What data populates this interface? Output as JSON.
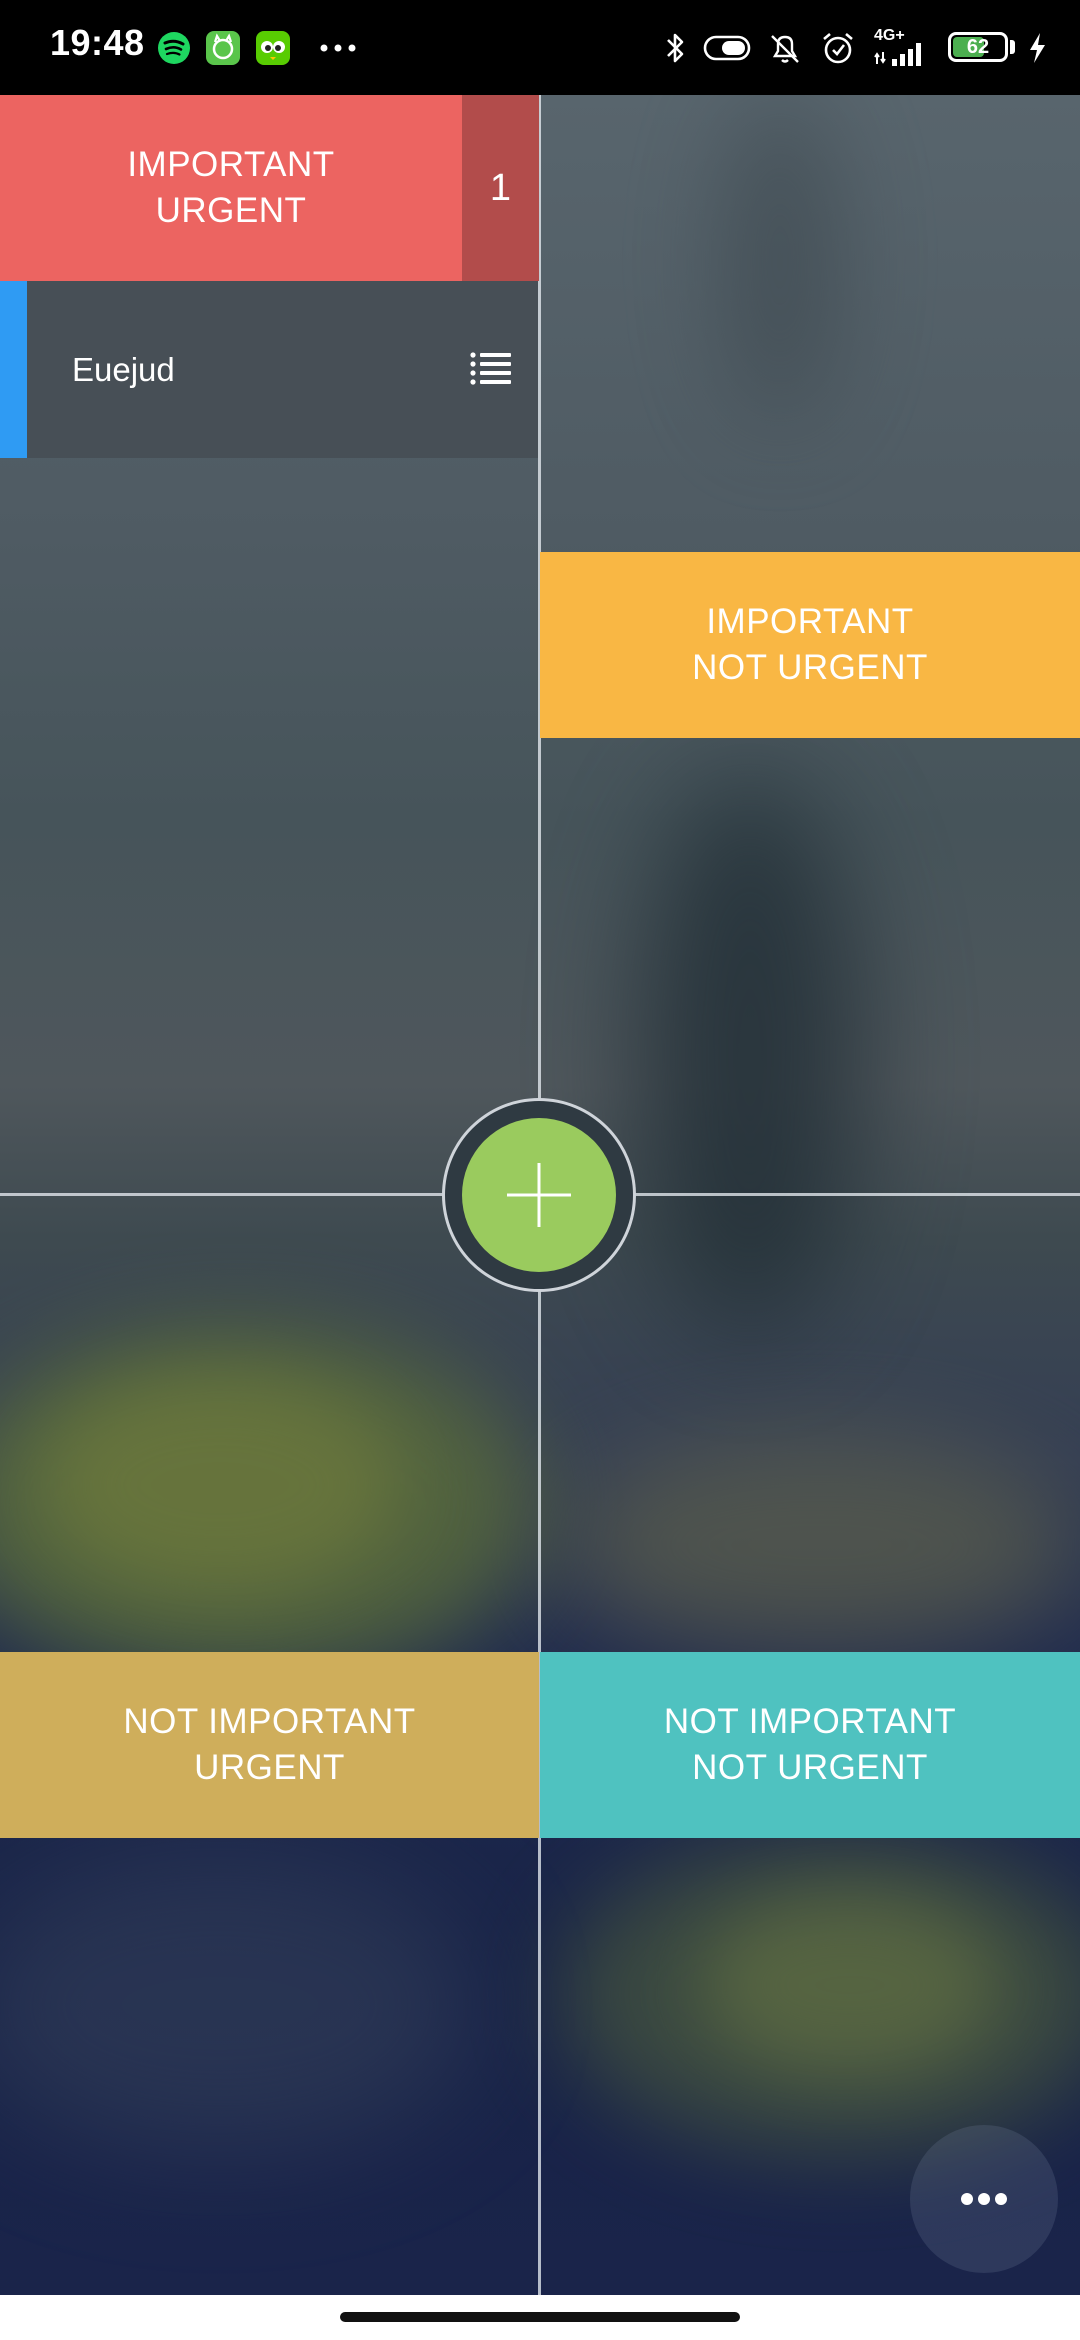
{
  "status_bar": {
    "time": "19:48",
    "left_icons": [
      "spotify-icon",
      "app-cat-icon",
      "duolingo-icon",
      "more-dots-icon"
    ],
    "right_icons": [
      "bluetooth-icon",
      "toggle-icon",
      "mute-bell-icon",
      "alarm-icon",
      "signal-4g-icon",
      "battery-icon",
      "charging-icon"
    ],
    "network_label": "4G+",
    "battery_level": "62",
    "battery_fraction": 0.62
  },
  "quadrants": {
    "important_urgent": {
      "line1": "IMPORTANT",
      "line2": "URGENT",
      "count": "1",
      "color": "#ec6461"
    },
    "important_not_urgent": {
      "line1": "IMPORTANT",
      "line2": "NOT URGENT",
      "color": "#f9b744"
    },
    "not_important_urgent": {
      "line1": "NOT IMPORTANT",
      "line2": "URGENT",
      "color": "#cfae5b"
    },
    "not_important_not_urgent": {
      "line1": "NOT IMPORTANT",
      "line2": "NOT URGENT",
      "color": "#4fc2c0"
    }
  },
  "tasks": [
    {
      "label": "Euejud",
      "marker_color": "#2f9bf3",
      "icon": "list-icon"
    }
  ],
  "actions": {
    "add_icon": "plus-icon",
    "add_color": "#9acb5e",
    "more_icon": "more-horizontal-icon"
  }
}
